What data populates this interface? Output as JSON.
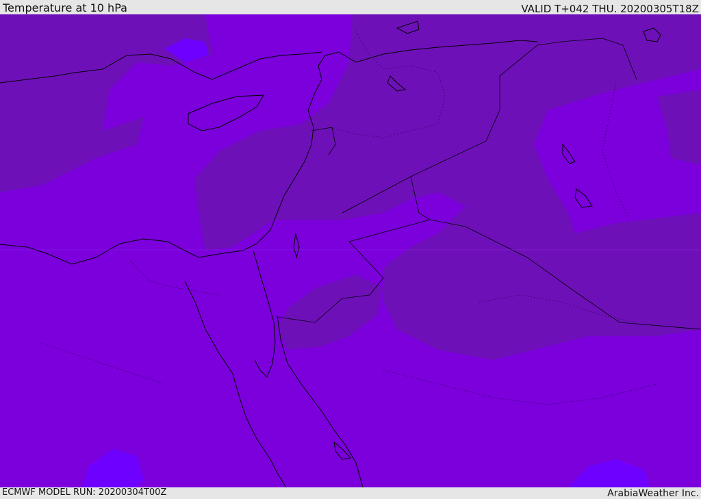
{
  "header": {
    "title": "Temperature at 10 hPa",
    "valid": "VALID T+042 THU. 20200305T18Z"
  },
  "footer": {
    "model_run": "ECMWF MODEL RUN: 20200304T00Z",
    "credit": "ArabiaWeather Inc."
  },
  "colors": {
    "field_base": "#7b00dc",
    "field_warm": "#6e10b8",
    "field_cool": "#6d00ff",
    "coastline": "#000000",
    "bars": "#e6e6e6"
  }
}
